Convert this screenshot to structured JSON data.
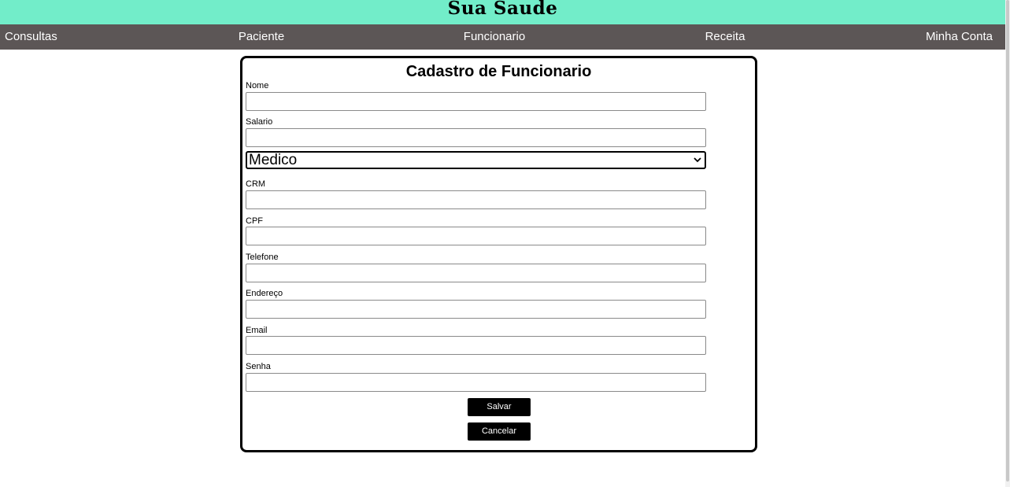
{
  "header": {
    "title": "Sua Saude"
  },
  "nav": {
    "items": [
      {
        "label": "Consultas"
      },
      {
        "label": "Paciente"
      },
      {
        "label": "Funcionario"
      },
      {
        "label": "Receita"
      },
      {
        "label": "Minha Conta"
      }
    ]
  },
  "form": {
    "title": "Cadastro de Funcionario",
    "fields": {
      "nome": {
        "label": "Nome",
        "value": ""
      },
      "salario": {
        "label": "Salario",
        "value": ""
      },
      "crm": {
        "label": "CRM",
        "value": ""
      },
      "cpf": {
        "label": "CPF",
        "value": ""
      },
      "telefone": {
        "label": "Telefone",
        "value": ""
      },
      "endereco": {
        "label": "Endereço",
        "value": ""
      },
      "email": {
        "label": "Email",
        "value": ""
      },
      "senha": {
        "label": "Senha",
        "value": ""
      }
    },
    "role_select": {
      "selected": "Medico",
      "icon": "chevron-down-icon"
    },
    "save_label": "Salvar",
    "cancel_label": "Cancelar"
  },
  "colors": {
    "header_bg": "#72edc9",
    "nav_bg": "#5c5656",
    "button_bg": "#000000"
  }
}
